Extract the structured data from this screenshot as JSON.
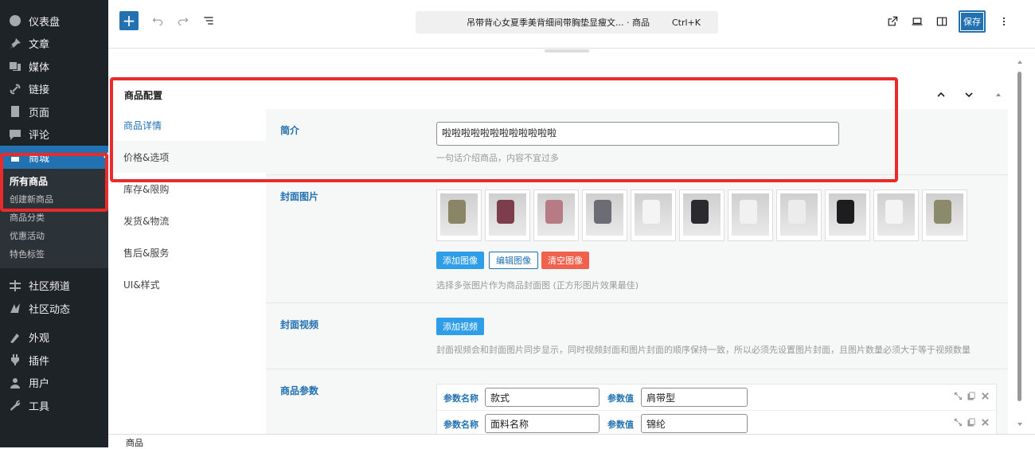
{
  "sidebar": {
    "items": [
      {
        "label": "仪表盘",
        "icon": "dashboard-icon"
      },
      {
        "label": "文章",
        "icon": "pin-icon"
      },
      {
        "label": "媒体",
        "icon": "media-icon"
      },
      {
        "label": "链接",
        "icon": "link-icon"
      },
      {
        "label": "页面",
        "icon": "page-icon"
      },
      {
        "label": "评论",
        "icon": "comment-icon"
      }
    ],
    "active": {
      "label": "商城",
      "icon": "store-icon"
    },
    "submenu": [
      "所有商品",
      "创建新商品",
      "商品分类",
      "优惠活动",
      "特色标签"
    ],
    "lower_items": [
      {
        "label": "社区频道",
        "icon": "channel-icon"
      },
      {
        "label": "社区动态",
        "icon": "activity-icon"
      }
    ],
    "bottom_items": [
      {
        "label": "外观",
        "icon": "appearance-icon"
      },
      {
        "label": "插件",
        "icon": "plugin-icon"
      },
      {
        "label": "用户",
        "icon": "user-icon"
      },
      {
        "label": "工具",
        "icon": "tools-icon"
      }
    ]
  },
  "topbar": {
    "doc_title": "吊带背心女夏季美背细间带胸垫显瘦文... · 商品",
    "shortcut": "Ctrl+K",
    "save_label": "保存"
  },
  "panel": {
    "title": "商品配置",
    "tabs": [
      "商品详情",
      "价格&选项",
      "库存&限购",
      "发货&物流",
      "售后&服务",
      "UI&样式"
    ],
    "active_tab": 0
  },
  "fields": {
    "intro": {
      "label": "简介",
      "value": "啦啦啦啦啦啦啦啦啦啦啦啦",
      "hint": "一句话介绍商品，内容不宜过多"
    },
    "cover": {
      "label": "封面图片",
      "add": "添加图像",
      "edit": "编辑图像",
      "clear": "清空图像",
      "hint": "选择多张图片作为商品封面图 (正方形图片效果最佳)",
      "thumb_colors": [
        "#8a8567",
        "#7d3e4c",
        "#b77b85",
        "#6c6c74",
        "#f4f4f4",
        "#2b2b2f",
        "#f1f1f1",
        "#ececec",
        "#1d1d1f",
        "#f4f4f4",
        "#8b8a6b"
      ]
    },
    "video": {
      "label": "封面视频",
      "add": "添加视频",
      "hint": "封面视频会和封面图片同步显示，同时视频封面和图片封面的顺序保持一致，所以必须先设置图片封面，且图片数量必须大于等于视频数量"
    },
    "params": {
      "label": "商品参数",
      "name_label": "参数名称",
      "value_label": "参数值",
      "rows": [
        {
          "name": "款式",
          "value": "肩带型"
        },
        {
          "name": "面料名称",
          "value": "锦纶"
        }
      ]
    }
  },
  "footer": {
    "breadcrumb": "商品"
  }
}
